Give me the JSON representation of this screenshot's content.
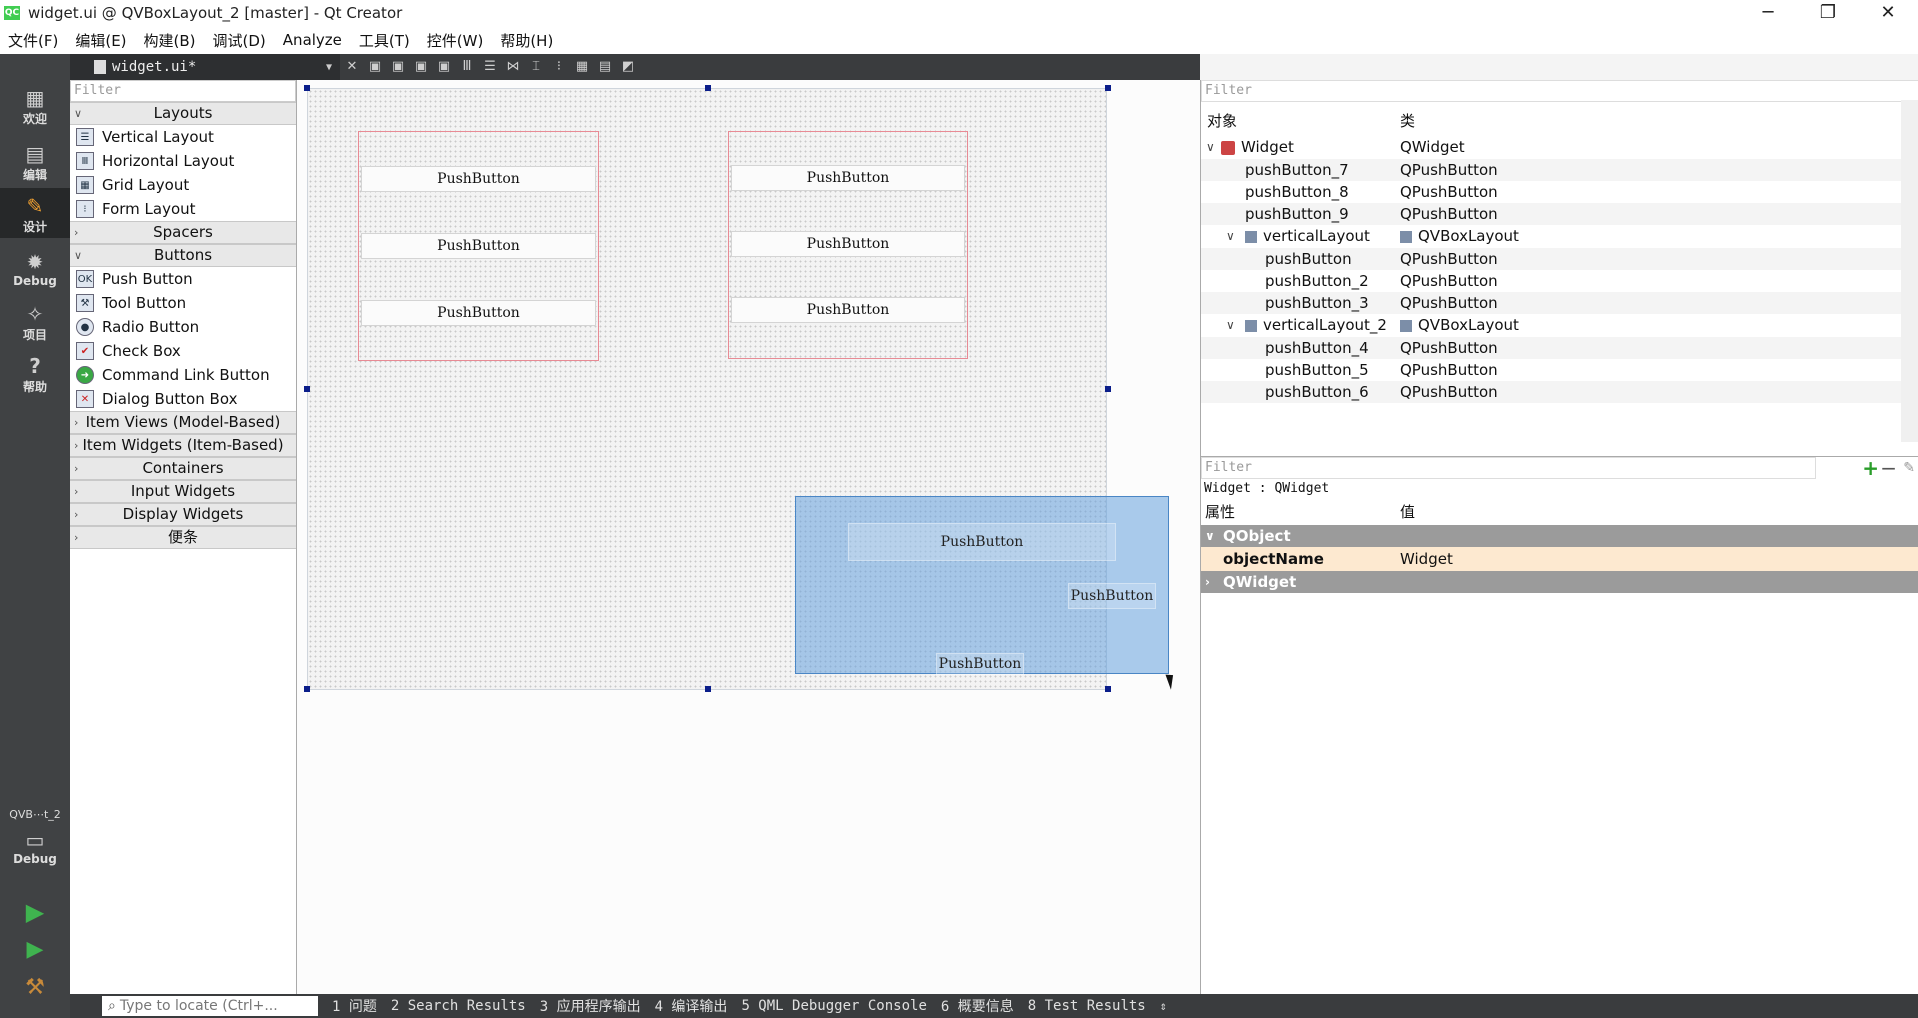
{
  "window": {
    "title": "widget.ui @ QVBoxLayout_2 [master] - Qt Creator",
    "app_icon_text": "QC",
    "controls": {
      "minimize": "─",
      "restore": "❐",
      "close": "✕"
    }
  },
  "menubar": [
    "文件(F)",
    "编辑(E)",
    "构建(B)",
    "调试(D)",
    "Analyze",
    "工具(T)",
    "控件(W)",
    "帮助(H)"
  ],
  "modebar": {
    "modes": [
      {
        "label": "欢迎",
        "icon": "grid-icon"
      },
      {
        "label": "编辑",
        "icon": "edit-icon"
      },
      {
        "label": "设计",
        "icon": "design-icon"
      },
      {
        "label": "Debug",
        "icon": "debug-icon"
      },
      {
        "label": "项目",
        "icon": "wrench-icon"
      },
      {
        "label": "帮助",
        "icon": "help-icon"
      }
    ],
    "target": "QVB⋯t_2",
    "target_mode": "Debug"
  },
  "toolbar": {
    "document": "widget.ui*",
    "close": "✕"
  },
  "widgetbox": {
    "filter_placeholder": "Filter",
    "categories": {
      "layouts": "Layouts",
      "spacers": "Spacers",
      "buttons": "Buttons",
      "item_views": "Item Views (Model-Based)",
      "item_widgets": "Item Widgets (Item-Based)",
      "containers": "Containers",
      "input_widgets": "Input Widgets",
      "display_widgets": "Display Widgets",
      "misc": "便条"
    },
    "layout_items": [
      "Vertical Layout",
      "Horizontal Layout",
      "Grid Layout",
      "Form Layout"
    ],
    "button_items": [
      "Push Button",
      "Tool Button",
      "Radio Button",
      "Check Box",
      "Command Link Button",
      "Dialog Button Box"
    ]
  },
  "form": {
    "button_label": "PushButton"
  },
  "object_inspector": {
    "filter_placeholder": "Filter",
    "col_object": "对象",
    "col_class": "类",
    "rows": [
      {
        "name": "Widget",
        "class": "QWidget"
      },
      {
        "name": "pushButton_7",
        "class": "QPushButton"
      },
      {
        "name": "pushButton_8",
        "class": "QPushButton"
      },
      {
        "name": "pushButton_9",
        "class": "QPushButton"
      },
      {
        "name": "verticalLayout",
        "class": "QVBoxLayout"
      },
      {
        "name": "pushButton",
        "class": "QPushButton"
      },
      {
        "name": "pushButton_2",
        "class": "QPushButton"
      },
      {
        "name": "pushButton_3",
        "class": "QPushButton"
      },
      {
        "name": "verticalLayout_2",
        "class": "QVBoxLayout"
      },
      {
        "name": "pushButton_4",
        "class": "QPushButton"
      },
      {
        "name": "pushButton_5",
        "class": "QPushButton"
      },
      {
        "name": "pushButton_6",
        "class": "QPushButton"
      }
    ]
  },
  "property_editor": {
    "filter_placeholder": "Filter",
    "caption": "Widget : QWidget",
    "col_property": "属性",
    "col_value": "值",
    "group_qobject": "QObject",
    "object_name_label": "objectName",
    "object_name_value": "Widget",
    "group_qwidget": "QWidget"
  },
  "statusbar": {
    "locate_placeholder": "Type to locate (Ctrl+...",
    "tabs": [
      "1 问题",
      "2 Search Results",
      "3 应用程序输出",
      "4 编译输出",
      "5 QML Debugger Console",
      "6 概要信息",
      "8 Test Results"
    ]
  },
  "colors": {
    "selection": "#6aa0d8",
    "layout_border": "#e88a94",
    "handle": "#0b1e8a"
  }
}
